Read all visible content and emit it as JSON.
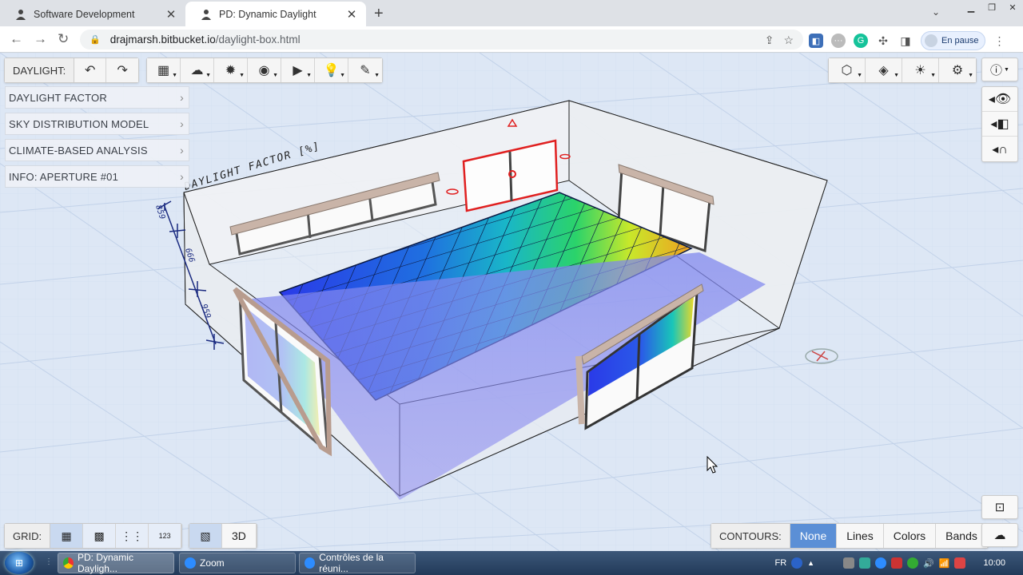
{
  "browser": {
    "tabs": [
      {
        "title": "Software Development"
      },
      {
        "title": "PD: Dynamic Daylight"
      }
    ],
    "url_host": "drajmarsh.bitbucket.io",
    "url_path": "/daylight-box.html",
    "profile_label": "En pause"
  },
  "app": {
    "toolbar_label": "DAYLIGHT:",
    "side_menu": [
      {
        "label": "DAYLIGHT FACTOR"
      },
      {
        "label": "SKY DISTRIBUTION MODEL"
      },
      {
        "label": "CLIMATE-BASED ANALYSIS"
      },
      {
        "label": "INFO: APERTURE #01"
      }
    ],
    "scene_label": "DAYLIGHT FACTOR [%]",
    "dimension_labels": [
      "859",
      "666",
      "959"
    ],
    "grid_label": "GRID:",
    "grid_number_icon": "123",
    "view_3d_label": "3D",
    "contours_label": "CONTOURS:",
    "contour_options": [
      {
        "label": "None",
        "active": true
      },
      {
        "label": "Lines",
        "active": false
      },
      {
        "label": "Colors",
        "active": false
      },
      {
        "label": "Bands",
        "active": false
      }
    ],
    "accent_color": "#5b8fd6"
  },
  "taskbar": {
    "items": [
      {
        "label": "PD: Dynamic Dayligh...",
        "icon": "chrome-icon",
        "active": true
      },
      {
        "label": "Zoom",
        "icon": "zoom-icon",
        "active": false
      },
      {
        "label": "Contrôles de la réuni...",
        "icon": "zoom-icon",
        "active": false
      }
    ],
    "language": "FR",
    "clock": "10:00"
  }
}
